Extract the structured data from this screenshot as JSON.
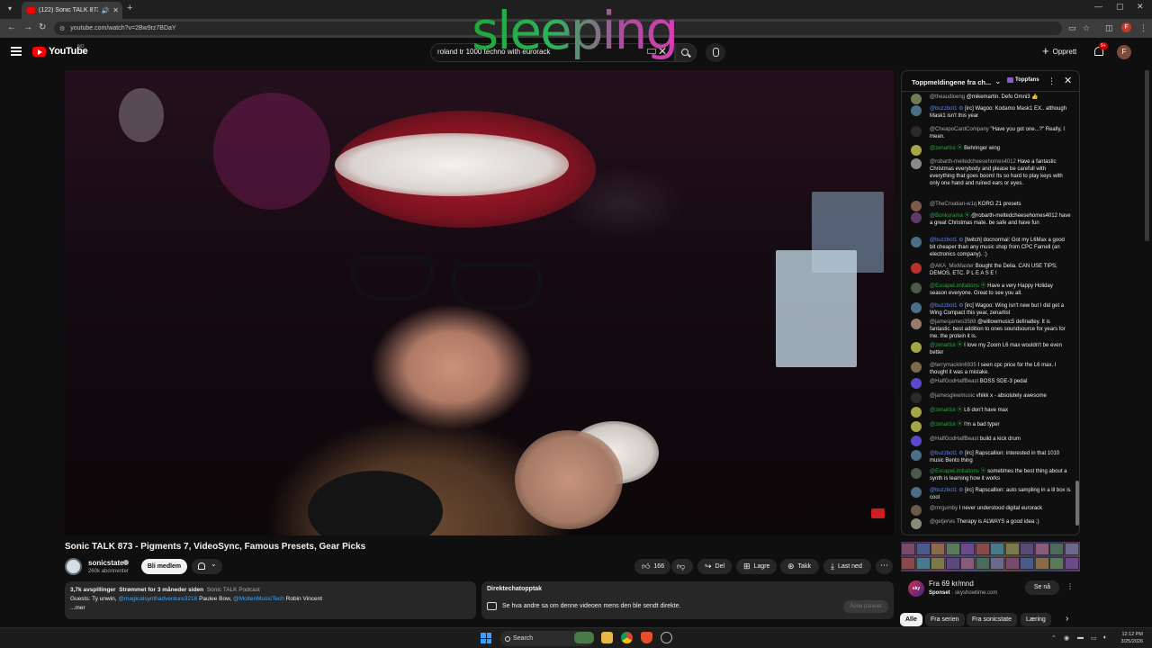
{
  "browser": {
    "tab_title": "(122) Sonic TALK 873 - Pigr",
    "url": "youtube.com/watch?v=2Bw9rz7BDaY"
  },
  "header": {
    "logo_text": "YouTube",
    "country": "NO",
    "search_value": "roland tr 1000 techno with eurorack",
    "create_label": "Opprett",
    "notif_count": "9+",
    "avatar_letter": "F"
  },
  "overlay": {
    "text": "sleeping"
  },
  "video": {
    "title": "Sonic TALK 873 - Pigments 7, VideoSync, Famous Presets, Gear Picks",
    "channel": "sonicstate",
    "subscribers": "260k abonnenter",
    "join_label": "Bli medlem",
    "likes": "166",
    "share_label": "Del",
    "save_label": "Lagre",
    "thanks_label": "Takk",
    "download_label": "Last ned"
  },
  "description": {
    "views": "3,7k avspillinger",
    "streamed": "Strømmet for 3 måneder siden",
    "podcast": "Sonic TALK Podcast",
    "guests_prefix": "Guests: Ty unwin,",
    "guest_link1": "@magicalsynthadventure3216",
    "guest_mid": "Paulee Bow,",
    "guest_link2": "@MoltenMusicTech",
    "guest_end": "Robin Vincent",
    "more": "...mer"
  },
  "chat_replay": {
    "title": "Direktechatopptak",
    "text": "Se hva andre sa om denne videoen mens den ble sendt direkte.",
    "button": "Åpne panelet"
  },
  "chat": {
    "header_title": "Toppmeldingene fra ch...",
    "topfans_label": "Toppfans",
    "messages": [
      {
        "author": "@theaudioeng",
        "text": "@mikemartin. Defo Omni3 👍",
        "color": "#6d7b57",
        "role": ""
      },
      {
        "author": "@buzzbot1 ⚙",
        "text": "[irc] Wagoo: Kodamo Mask1 EX.. although Mask1 isn't this year",
        "color": "#4a6f86",
        "role": "mod"
      },
      {
        "author": "@CheapoCardCompany",
        "text": "\"Have you got one...?\" Really, I mean.",
        "color": "#2b2b2b",
        "role": ""
      },
      {
        "author": "@zenartist ⦿",
        "text": "Behringer wing",
        "color": "#a5a64a",
        "role": "mem"
      },
      {
        "author": "@robarth-meltedcheesehomes4012",
        "text": "Have a fantastic Christmas everybody and please be carefull with everything that goes boom! Its so hard to play keys with only one hand and ruined ears or eyes.",
        "color": "#8a8a8a",
        "role": ""
      },
      {
        "author": "@TheCroatian-w1q",
        "text": "KORG Z1 presets",
        "color": "#7d5a4a",
        "role": ""
      },
      {
        "author": "@Bonkorama ⦿",
        "text": "@robarth-meltedcheesehomes4012 have a great Christmas mate. be safe and have fun",
        "color": "#5e3a6b",
        "role": "mem"
      },
      {
        "author": "@buzzbot1 ⚙",
        "text": "[twitch] docnormal: Got my L6Max a good bit cheaper than any music shop from CPC Farnell (an electronics company). :)",
        "color": "#4a6f86",
        "role": "mod"
      },
      {
        "author": "@AKA_MixMaster",
        "text": "Bought the Delia. CAN USE TIPS, DEMOS, ETC. P L E A S E !",
        "color": "#b8312f",
        "role": ""
      },
      {
        "author": "@EscapeLimitations ⦿",
        "text": "Have a very Happy Holiday season everyone. Great to see you all.",
        "color": "#4d5a4a",
        "role": "mem"
      },
      {
        "author": "@buzzbot1 ⚙",
        "text": "[irc] Wagoo: Wing isn't new but I did get a Wing Compact this year, zenartist",
        "color": "#4a6f86",
        "role": "mod"
      },
      {
        "author": "@jamesjames3588",
        "text": "@willowmusic5 definatley. It is fantastic. best addition to ones soundsource for years for me. the protein it is.",
        "color": "#9a7a6a",
        "role": ""
      },
      {
        "author": "@zenartist ⦿",
        "text": "I love my Zoom L6 max wouldn't be even better",
        "color": "#a5a64a",
        "role": "mem"
      },
      {
        "author": "@terrymacklin6935",
        "text": "I seen cpc price for the L6 max. I thought it was a mistake.",
        "color": "#7a6a4a",
        "role": ""
      },
      {
        "author": "@HalfGodHalfBeast",
        "text": "BOSS SDE-3 pedal",
        "color": "#5a4ac7",
        "role": ""
      },
      {
        "author": "@jamesglewmusic",
        "text": "vhikk x - absolutely awesome",
        "color": "#2b2b2b",
        "role": ""
      },
      {
        "author": "@zenartist ⦿",
        "text": "L6 don't have max",
        "color": "#a5a64a",
        "role": "mem"
      },
      {
        "author": "@zenartist ⦿",
        "text": "I'm a bad typer",
        "color": "#a5a64a",
        "role": "mem"
      },
      {
        "author": "@HalfGodHalfBeast",
        "text": "build a kick drum",
        "color": "#5a4ac7",
        "role": ""
      },
      {
        "author": "@buzzbot1 ⚙",
        "text": "[irc] Rapscallion: interested in that 1010 music Bento thing",
        "color": "#4a6f86",
        "role": "mod"
      },
      {
        "author": "@EscapeLimitations ⦿",
        "text": "sometimes the best thing about a synth is learning how it works",
        "color": "#4d5a4a",
        "role": "mem"
      },
      {
        "author": "@buzzbot1 ⚙",
        "text": "[irc] Rapscallion: auto sampling in a lil box is cool",
        "color": "#4a6f86",
        "role": "mod"
      },
      {
        "author": "@mrgumby",
        "text": "I never understood digital eurorack",
        "color": "#6a5a4a",
        "role": ""
      },
      {
        "author": "@getjervis",
        "text": "Therapy is ALWAYS a good idea ;)",
        "color": "#8a8a7a",
        "role": ""
      }
    ]
  },
  "ad": {
    "logo": "sky",
    "title": "Fra 69 kr/mnd",
    "sponsor_label": "Sponset",
    "domain": "skyshowtime.com",
    "button": "Se nå"
  },
  "chips": [
    "Alle",
    "Fra serien",
    "Fra sonicstate",
    "Læring"
  ],
  "taskbar": {
    "search_label": "Search",
    "time": "12:12 PM",
    "date": "3/25/2026"
  }
}
